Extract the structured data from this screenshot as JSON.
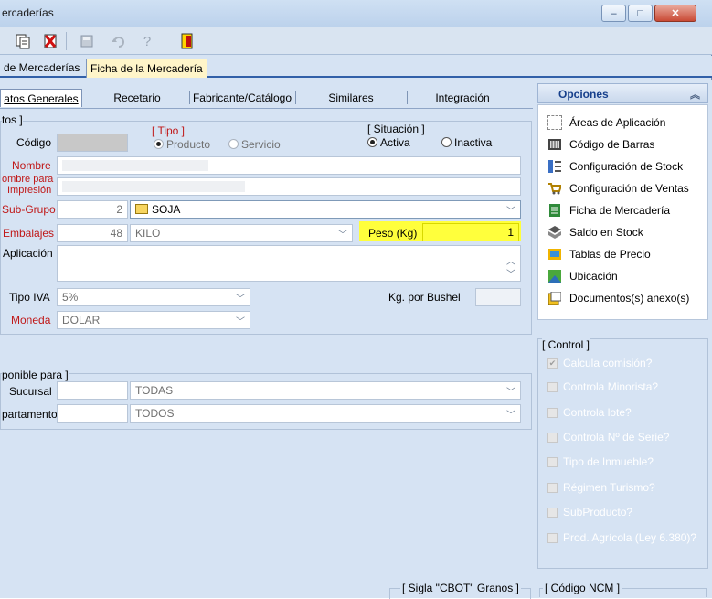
{
  "window": {
    "title": "ercaderías",
    "min": "–",
    "max": "□",
    "close": "✕"
  },
  "tabs": [
    "de Mercaderías",
    "Ficha de la Mercadería"
  ],
  "subtabs": [
    "atos Generales",
    "Recetario",
    "Fabricante/Catálogo",
    "Similares",
    "Integración"
  ],
  "form": {
    "group1_title": "tos ]",
    "codigo_label": "Código",
    "tipo_title": "[ Tipo ]",
    "tipo_producto": "Producto",
    "tipo_servicio": "Servicio",
    "situacion_title": "[ Situación ]",
    "situacion_activa": "Activa",
    "situacion_inactiva": "Inactiva",
    "nombre_label": "Nombre",
    "nombre_impresion_label1": "ombre para",
    "nombre_impresion_label2": "Impresión",
    "subgrupo_label": "Sub-Grupo",
    "subgrupo_code": "2",
    "subgrupo_value": "SOJA",
    "embalajes_label": "Embalajes",
    "embalajes_code": "48",
    "embalajes_value": "KILO",
    "peso_label": "Peso (Kg)",
    "peso_value": "1",
    "aplicacion_label": "Aplicación",
    "tipo_iva_label": "Tipo IVA",
    "tipo_iva_value": "5%",
    "kg_bushel_label": "Kg. por Bushel",
    "moneda_label": "Moneda",
    "moneda_value": "DOLAR",
    "disp_title": "ponible para ]",
    "sucursal_label": "Sucursal",
    "sucursal_value": "TODAS",
    "departamento_label": "partamento",
    "departamento_value": "TODOS",
    "sigla_title": "[ Sigla \"CBOT\" Granos ]",
    "ncm_title": "[ Código NCM ]"
  },
  "options": {
    "title": "Opciones",
    "items": [
      "Áreas de Aplicación",
      "Código de Barras",
      "Configuración de Stock",
      "Configuración de Ventas",
      "Ficha de Mercadería",
      "Saldo en Stock",
      "Tablas de Precio",
      "Ubicación",
      "Documentos(s) anexo(s)"
    ]
  },
  "control": {
    "title": "[ Control ]",
    "items": [
      "Calcula comisión?",
      "Controla Minorista?",
      "Controla lote?",
      "Controla Nº de Serie?",
      "Tipo de Inmueble?",
      "Régimen Turismo?",
      "SubProducto?",
      "Prod. Agrícola (Ley 6.380)?"
    ],
    "checked": [
      true,
      false,
      false,
      false,
      false,
      false,
      false,
      false
    ]
  },
  "colors": {
    "highlight": "#ffff3c",
    "required_label": "#c01818",
    "accent": "#17408c"
  }
}
